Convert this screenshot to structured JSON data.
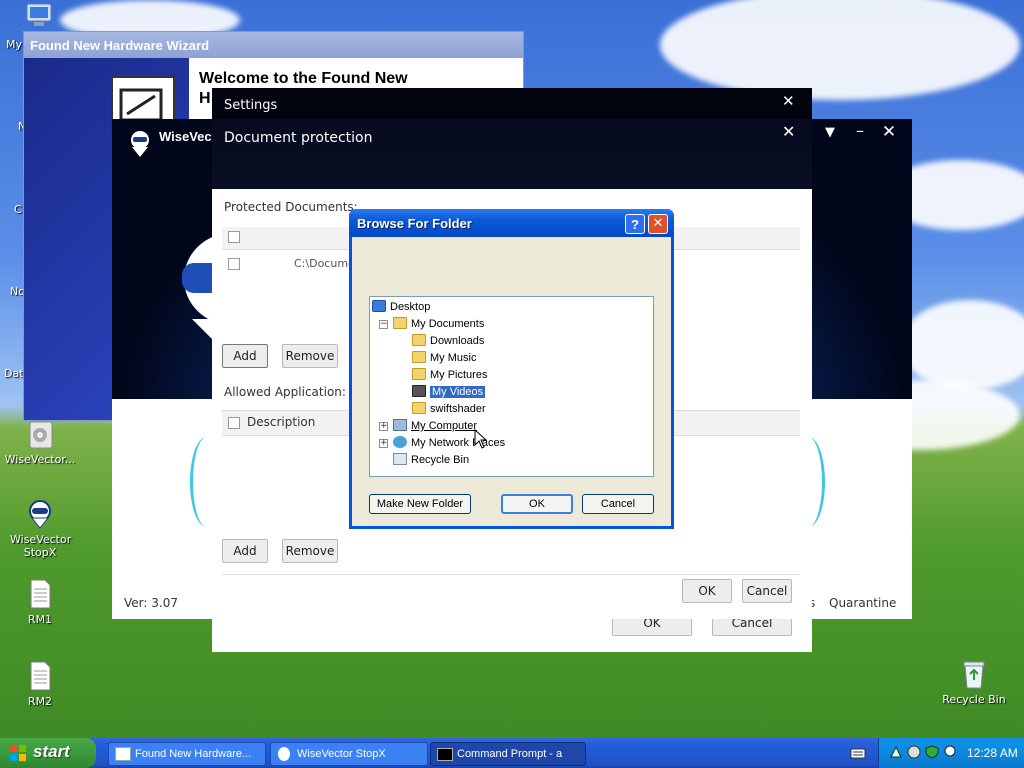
{
  "desktop": {
    "icons": [
      {
        "label": "My"
      },
      {
        "label": "WiseVector..."
      },
      {
        "label": "WiseVector StopX"
      },
      {
        "label": "RM1"
      },
      {
        "label": "RM2"
      },
      {
        "label": "Recycle Bin"
      }
    ],
    "edge_letters": [
      "N",
      "C",
      "No",
      "Dat"
    ]
  },
  "hardware_wizard": {
    "title": "Found New Hardware Wizard",
    "heading_line1": "Welcome to the Found New",
    "heading_line2": "H"
  },
  "wisevector_main": {
    "app_name": "WiseVector",
    "version": "Ver: 3.07",
    "quarantine_label": "Quarantine",
    "partial_s": "s"
  },
  "settings": {
    "title": "Settings",
    "ok_label": "OK",
    "cancel_label": "Cancel"
  },
  "doc_protection": {
    "title": "Document protection",
    "protected_label": "Protected Documents:",
    "protected_rows": [
      {
        "path": "C:\\Docume"
      }
    ],
    "add_label": "Add",
    "remove_label": "Remove",
    "allowed_label": "Allowed Application:",
    "allowed_header": "Description",
    "add2_label": "Add",
    "remove2_label": "Remove",
    "ok_label": "OK",
    "cancel_label": "Cancel"
  },
  "browse": {
    "title": "Browse For Folder",
    "help_symbol": "?",
    "tree": [
      {
        "label": "Desktop",
        "level": 0
      },
      {
        "label": "My Documents",
        "level": 1,
        "expander": "−"
      },
      {
        "label": "Downloads",
        "level": 2
      },
      {
        "label": "My Music",
        "level": 2
      },
      {
        "label": "My Pictures",
        "level": 2
      },
      {
        "label": "My Videos",
        "level": 2,
        "selected": true
      },
      {
        "label": "swiftshader",
        "level": 2
      },
      {
        "label": "My Computer",
        "level": 1,
        "expander": "+"
      },
      {
        "label": "My Network Places",
        "level": 1,
        "expander": "+"
      },
      {
        "label": "Recycle Bin",
        "level": 1
      }
    ],
    "make_new_folder_label": "Make New Folder",
    "ok_label": "OK",
    "cancel_label": "Cancel"
  },
  "taskbar": {
    "start_label": "start",
    "tasks": [
      {
        "label": "Found New Hardware..."
      },
      {
        "label": "WiseVector StopX"
      },
      {
        "label": "Command Prompt - a"
      }
    ],
    "clock": "12:28 AM"
  },
  "colors": {
    "xp_blue": "#0a246a",
    "xp_title": "#0054e3",
    "selection": "#316ac5",
    "start_green": "#3c9a3c"
  }
}
